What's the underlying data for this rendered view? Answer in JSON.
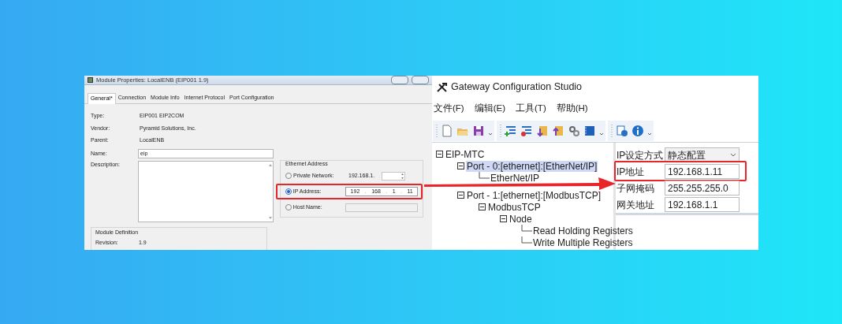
{
  "left_window": {
    "title": "Module Properties: LocalENB (EIP001 1.9)",
    "tabs": [
      {
        "label": "General*",
        "selected": true
      },
      {
        "label": "Connection",
        "selected": false
      },
      {
        "label": "Module Info",
        "selected": false
      },
      {
        "label": "Internet Protocol",
        "selected": false
      },
      {
        "label": "Port Configuration",
        "selected": false
      }
    ],
    "info": [
      {
        "label": "Type:",
        "value": "EIP001 EIP2COM"
      },
      {
        "label": "Vendor:",
        "value": "Pyramid Solutions, Inc."
      },
      {
        "label": "Parent:",
        "value": "LocalENB"
      }
    ],
    "name": {
      "label": "Name:",
      "value": "eip"
    },
    "description": {
      "label": "Description:"
    },
    "module_definition": {
      "title": "Module Definition",
      "rows": [
        {
          "label": "Revision:",
          "value": "1.9"
        }
      ]
    },
    "ethernet_address": {
      "title": "Ethernet Address",
      "options": [
        {
          "kind": "spinner",
          "label": "Private Network:",
          "prefix": "192.168.1.",
          "selected": false,
          "highlighted": false
        },
        {
          "kind": "octets",
          "label": "IP Address:",
          "octets": [
            "192",
            "168",
            "1",
            "11"
          ],
          "separator": ".",
          "selected": true,
          "highlighted": true
        },
        {
          "kind": "field",
          "label": "Host Name:",
          "selected": false,
          "highlighted": false
        }
      ]
    }
  },
  "right_window": {
    "title": "Gateway Configuration Studio",
    "menu": [
      "文件(F)",
      "编辑(E)",
      "工具(T)",
      "帮助(H)"
    ],
    "tree": [
      {
        "label": "EIP-MTC",
        "selected": false,
        "expanded": true,
        "children": [
          {
            "label": "Port - 0:[ethernet]:[EtherNet/IP]",
            "selected": true,
            "expanded": true,
            "children": [
              {
                "label": "EtherNet/IP",
                "selected": false,
                "expanded": false
              }
            ]
          },
          {
            "label": "Port - 1:[ethernet]:[ModbusTCP]",
            "selected": false,
            "expanded": true,
            "children": [
              {
                "label": "ModbusTCP",
                "selected": false,
                "expanded": true,
                "children": [
                  {
                    "label": "Node",
                    "selected": false,
                    "expanded": true,
                    "children": [
                      {
                        "label": "Read Holding Registers",
                        "selected": false,
                        "expanded": false
                      },
                      {
                        "label": "Write Multiple Registers",
                        "selected": false,
                        "expanded": false
                      }
                    ]
                  }
                ]
              }
            ]
          }
        ]
      }
    ],
    "properties": [
      {
        "kind": "dropdown",
        "label": "IP设定方式",
        "value": "静态配置",
        "highlighted": false
      },
      {
        "kind": "text",
        "label": "IP地址",
        "value": "192.168.1.11",
        "highlighted": true
      },
      {
        "kind": "text",
        "label": "子网掩码",
        "value": "255.255.255.0",
        "highlighted": false
      },
      {
        "kind": "text",
        "label": "网关地址",
        "value": "192.168.1.1",
        "highlighted": false
      }
    ]
  }
}
